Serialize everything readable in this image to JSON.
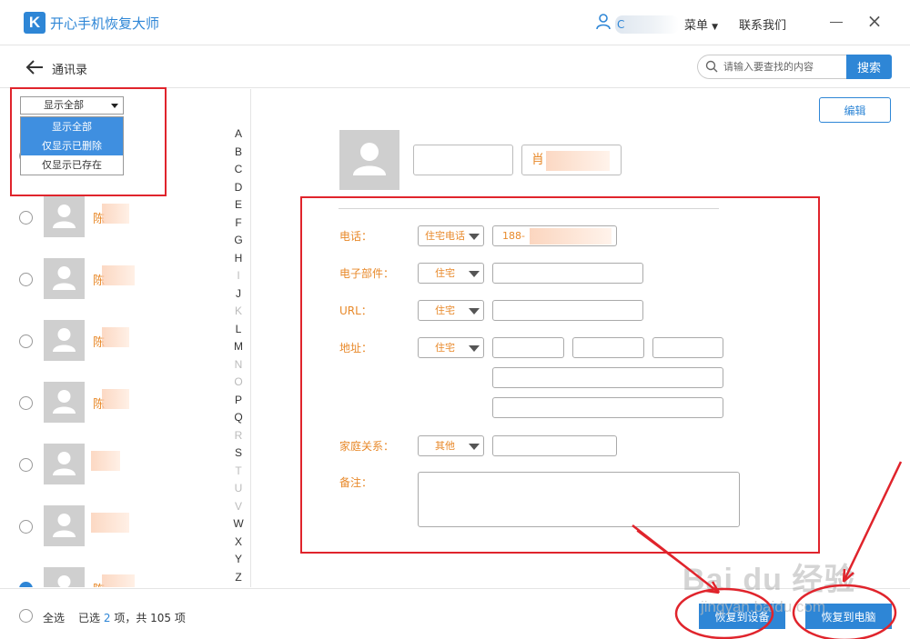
{
  "app": {
    "logo_letter": "K",
    "title": "开心手机恢复大师",
    "user_initial": "C",
    "menu_label": "菜单",
    "contact_us": "联系我们"
  },
  "nav": {
    "page_title": "通讯录",
    "search_placeholder": "请输入要查找的内容",
    "search_button": "搜索"
  },
  "filter": {
    "selected": "显示全部",
    "options": [
      "显示全部",
      "仅显示已删除",
      "仅显示已存在"
    ],
    "highlighted_option": "仅显示已删除"
  },
  "contacts": [
    {
      "name": "",
      "checked": false
    },
    {
      "name": "陈",
      "checked": false
    },
    {
      "name": "陈",
      "checked": false
    },
    {
      "name": "陈",
      "checked": false
    },
    {
      "name": "陈",
      "checked": false
    },
    {
      "name": "",
      "checked": false
    },
    {
      "name": "",
      "checked": false
    },
    {
      "name": "陈",
      "checked": true
    }
  ],
  "alphabet": [
    "A",
    "B",
    "C",
    "D",
    "E",
    "F",
    "G",
    "H",
    "I",
    "J",
    "K",
    "L",
    "M",
    "N",
    "O",
    "P",
    "Q",
    "R",
    "S",
    "T",
    "U",
    "V",
    "W",
    "X",
    "Y",
    "Z"
  ],
  "alphabet_dim": [
    "I",
    "K",
    "N",
    "O",
    "R",
    "T",
    "U",
    "V"
  ],
  "detail": {
    "edit_button": "编辑",
    "last_name": "",
    "first_name": "肖",
    "phone": {
      "label": "电话：",
      "type": "住宅电话",
      "value": "188-"
    },
    "email": {
      "label": "电子部件：",
      "type": "住宅",
      "value": ""
    },
    "url": {
      "label": "URL：",
      "type": "住宅",
      "value": ""
    },
    "address": {
      "label": "地址：",
      "type": "住宅"
    },
    "relation": {
      "label": "家庭关系：",
      "type": "其他",
      "value": ""
    },
    "notes": {
      "label": "备注：",
      "value": ""
    }
  },
  "footer": {
    "select_all": "全选",
    "selected_prefix": "已选",
    "selected_count": "2",
    "selected_suffix": "项，共 105 项",
    "restore_device": "恢复到设备",
    "restore_pc": "恢复到电脑"
  },
  "watermark": {
    "main": "Bai du 经验",
    "sub": "jingyan.baidu.com"
  },
  "colors": {
    "accent": "#2e86d6",
    "label_orange": "#e8892a",
    "annotation_red": "#e0242c"
  }
}
